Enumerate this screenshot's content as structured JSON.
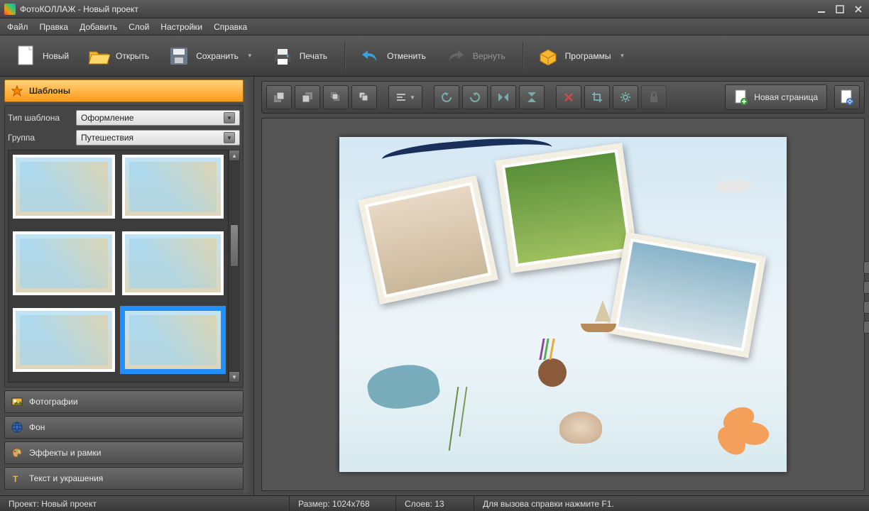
{
  "window": {
    "title": "ФотоКОЛЛАЖ - Новый проект"
  },
  "menu": {
    "items": [
      "Файл",
      "Правка",
      "Добавить",
      "Слой",
      "Настройки",
      "Справка"
    ]
  },
  "toolbar": {
    "new": "Новый",
    "open": "Открыть",
    "save": "Сохранить",
    "print": "Печать",
    "undo": "Отменить",
    "redo": "Вернуть",
    "programs": "Программы"
  },
  "sidebar": {
    "templates": {
      "title": "Шаблоны",
      "type_label": "Тип шаблона",
      "type_value": "Оформление",
      "group_label": "Группа",
      "group_value": "Путешествия"
    },
    "panels": {
      "photos": "Фотографии",
      "background": "Фон",
      "effects": "Эффекты и рамки",
      "text": "Текст и украшения"
    }
  },
  "canvas_toolbar": {
    "new_page": "Новая страница"
  },
  "status": {
    "project": "Проект: Новый проект",
    "size": "Размер: 1024x768",
    "layers": "Слоев: 13",
    "help": "Для вызова справки нажмите F1."
  }
}
